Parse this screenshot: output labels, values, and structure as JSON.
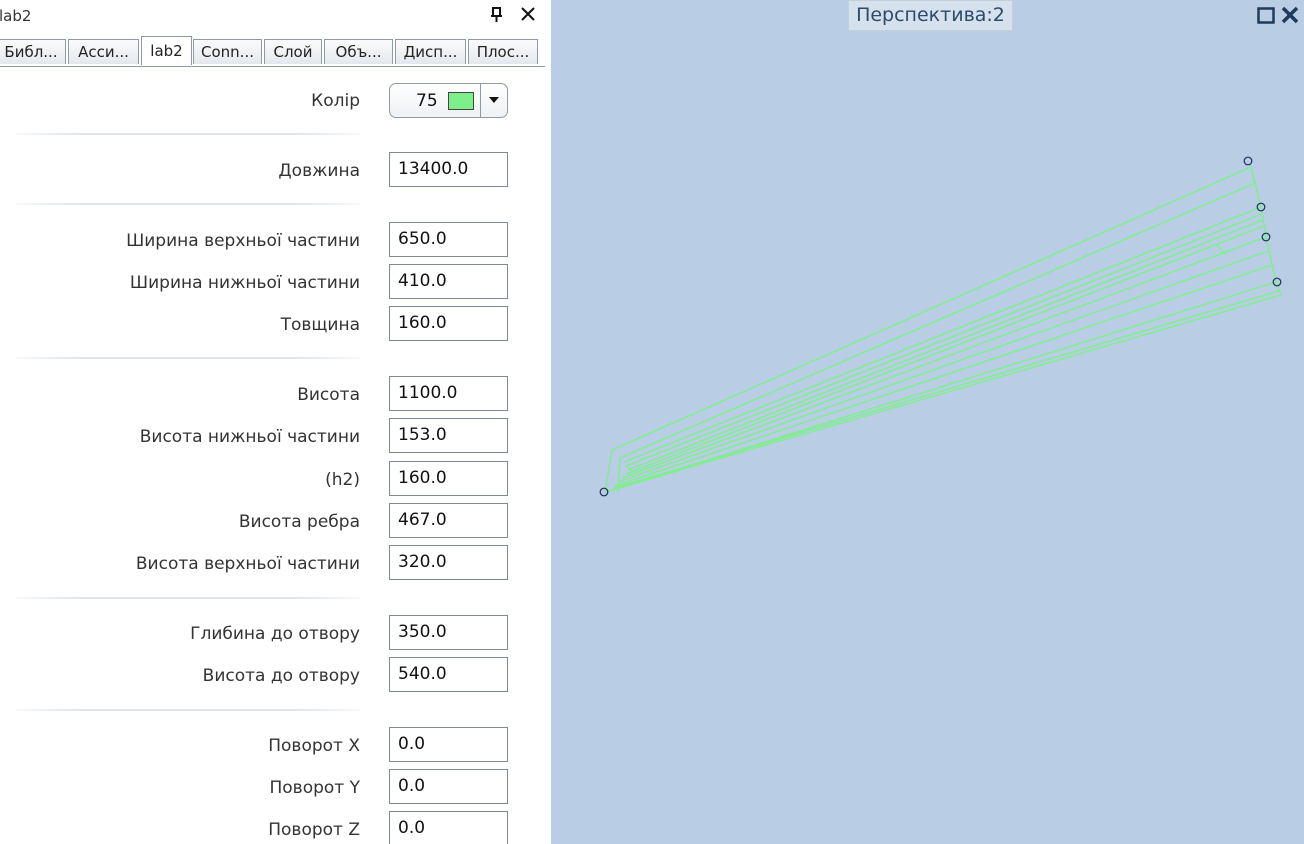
{
  "panel": {
    "title": "lab2",
    "tabs": [
      {
        "label": "Библ..."
      },
      {
        "label": "Асси..."
      },
      {
        "label": "lab2"
      },
      {
        "label": "Conn..."
      },
      {
        "label": "Слой"
      },
      {
        "label": "Объ..."
      },
      {
        "label": "Дисп..."
      },
      {
        "label": "Плос..."
      }
    ],
    "active_tab": "lab2"
  },
  "props": {
    "color_label": "Колір",
    "color_value": "75",
    "color_swatch": "#7df08a",
    "length_label": "Довжина",
    "length": "13400.0",
    "top_width_label": "Ширина верхньої частини",
    "top_width": "650.0",
    "bottom_width_label": "Ширина нижньої частини",
    "bottom_width": "410.0",
    "thickness_label": "Товщина",
    "thickness": "160.0",
    "height_label": "Висота",
    "height": "1100.0",
    "bottom_height_label": "Висота нижньої частини",
    "bottom_height": "153.0",
    "h2_label": "(h2)",
    "h2": "160.0",
    "rib_height_label": "Висота ребра",
    "rib_height": "467.0",
    "top_height_label": "Висота верхньої частини",
    "top_height": "320.0",
    "hole_depth_label": "Глибина до отвору",
    "hole_depth": "350.0",
    "hole_height_label": "Висота до отвору",
    "hole_height": "540.0",
    "rot_x_label": "Поворот X",
    "rot_x": "0.0",
    "rot_y_label": "Поворот Y",
    "rot_y": "0.0",
    "rot_z_label": "Поворот Z",
    "rot_z": "0.0"
  },
  "viewport": {
    "title": "Перспектива:2",
    "background": "#b9cde4",
    "model_color": "#7df08a"
  }
}
